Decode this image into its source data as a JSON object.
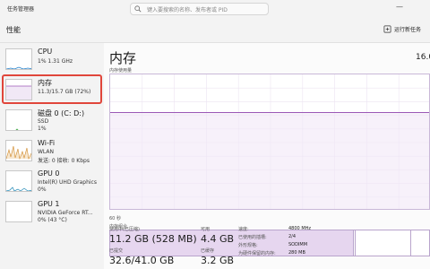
{
  "window": {
    "title": "任务管理器",
    "search_placeholder": "键入要搜索的名称、发布者或 PID",
    "minimize": "—"
  },
  "header": {
    "page": "性能",
    "run_task": "运行新任务"
  },
  "sidebar": {
    "items": [
      {
        "title": "CPU",
        "sub1": "1% 1.31 GHz",
        "sub2": "",
        "sub3": ""
      },
      {
        "title": "内存",
        "sub1": "11.3/15.7 GB (72%)",
        "sub2": "",
        "sub3": ""
      },
      {
        "title": "磁盘 0 (C: D:)",
        "sub1": "SSD",
        "sub2": "1%",
        "sub3": ""
      },
      {
        "title": "Wi-Fi",
        "sub1": "WLAN",
        "sub2": "发送: 0 接收: 0 Kbps",
        "sub3": ""
      },
      {
        "title": "GPU 0",
        "sub1": "Intel(R) UHD Graphics",
        "sub2": "0%",
        "sub3": ""
      },
      {
        "title": "GPU 1",
        "sub1": "NVIDIA GeForce RT...",
        "sub2": "0% (43 °C)",
        "sub3": ""
      }
    ]
  },
  "main": {
    "title": "内存",
    "total": "16.0",
    "usage_label": "内存使用量",
    "time_label": "60 秒",
    "composition_label": "内存组合",
    "memory_percent": 72,
    "stats": {
      "in_use_label": "使用中(已压缩)",
      "in_use_value": "11.2 GB (528 MB)",
      "available_label": "可用",
      "available_value": "4.4 GB",
      "committed_label": "已提交",
      "committed_value": "32.6/41.0 GB",
      "cached_label": "已缓存",
      "cached_value": "3.2 GB"
    },
    "details": [
      {
        "key": "速度:",
        "value": "4800 MHz"
      },
      {
        "key": "已使用的插槽:",
        "value": "2/4"
      },
      {
        "key": "外形规格:",
        "value": "SODIMM"
      },
      {
        "key": "为硬件保留的内存:",
        "value": "280 MB"
      }
    ]
  },
  "colors": {
    "memory_accent": "#9b59b6",
    "memory_fill": "#f1e8f6",
    "cpu_accent": "#1f7fcb",
    "disk_accent": "#4caf50",
    "wifi_accent": "#d08a2c",
    "gpu_accent": "#1f88b6",
    "highlight": "#e0463b"
  }
}
